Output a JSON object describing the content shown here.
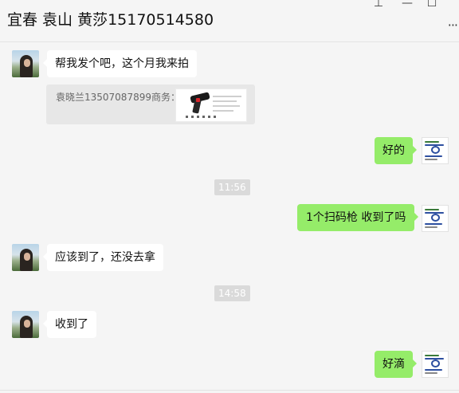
{
  "header": {
    "title": "宜春 袁山 黄莎15170514580",
    "pin_glyph": "⊥",
    "minimize_glyph": "—",
    "maximize_glyph": "☐",
    "more_glyph": "···"
  },
  "messages": {
    "m1": {
      "text": "帮我发个吧，这个月我来拍",
      "sender": "contact"
    },
    "quote": {
      "text": "袁晓兰13507087899商务：",
      "thumbnail": "barcode-scanner-product-image"
    },
    "m2": {
      "text": "好的",
      "sender": "me"
    },
    "time1": "11:56",
    "m3": {
      "text": "1个扫码枪 收到了吗",
      "sender": "me"
    },
    "m4": {
      "text": "应该到了，还没去拿",
      "sender": "contact"
    },
    "time2": "14:58",
    "m5": {
      "text": "收到了",
      "sender": "contact"
    },
    "m6": {
      "text": "好滴",
      "sender": "me"
    }
  },
  "colors": {
    "background": "#f5f5f5",
    "my_bubble": "#95ec69",
    "their_bubble": "#ffffff",
    "quote_bg": "#e7e7e7",
    "timestamp_bg": "#dadada"
  }
}
